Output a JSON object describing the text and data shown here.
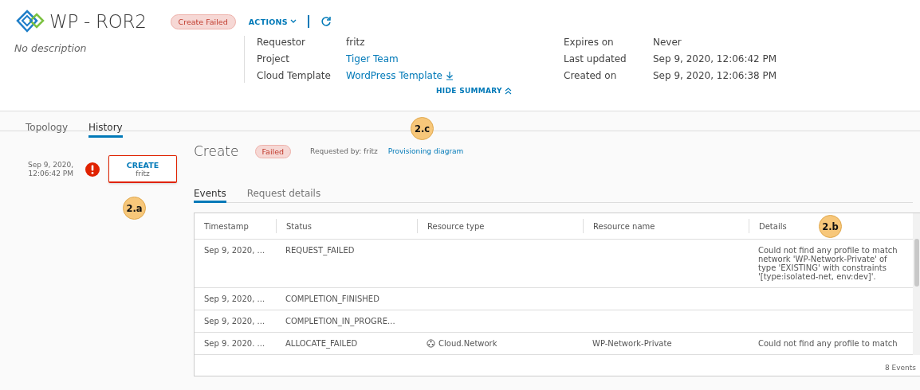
{
  "header": {
    "title": "WP - ROR2",
    "status": "Create Failed",
    "actions": "ACTIONS",
    "description": "No description",
    "summary_left": [
      {
        "label": "Requestor",
        "value": "fritz",
        "link": false,
        "download": false
      },
      {
        "label": "Project",
        "value": "Tiger Team",
        "link": true,
        "download": false
      },
      {
        "label": "Cloud Template",
        "value": "WordPress Template",
        "link": true,
        "download": true
      }
    ],
    "summary_right": [
      {
        "label": "Expires on",
        "value": "Never"
      },
      {
        "label": "Last updated",
        "value": "Sep 9, 2020, 12:06:42 PM"
      },
      {
        "label": "Created on",
        "value": "Sep 9, 2020, 12:06:38 PM"
      }
    ],
    "hide_summary": "HIDE SUMMARY"
  },
  "tabs": [
    {
      "label": "Topology",
      "selected": false
    },
    {
      "label": "History",
      "selected": true
    }
  ],
  "timeline": [
    {
      "date": "Sep 9, 2020,",
      "time": "12:06:42 PM",
      "failed": true,
      "action": "CREATE",
      "user": "fritz",
      "annotation": "2.a"
    }
  ],
  "request": {
    "title": "Create",
    "status": "Failed",
    "requested_by": "Requested by: fritz",
    "link": "Provisioning diagram",
    "annotation": "2.c"
  },
  "detail_tabs": [
    {
      "label": "Events",
      "selected": true
    },
    {
      "label": "Request details",
      "selected": false
    }
  ],
  "table": {
    "columns": [
      {
        "label": "Timestamp"
      },
      {
        "label": "Status"
      },
      {
        "label": "Resource type"
      },
      {
        "label": "Resource name"
      },
      {
        "label": "Details",
        "annotation": "2.b"
      }
    ],
    "rows": [
      {
        "timestamp": "Sep 9, 2020, ...",
        "status": "REQUEST_FAILED",
        "details": "Could not find any profile to match network 'WP-Network-Private' of type 'EXISTING' with constraints '[type:isolated-net, env:dev]'."
      },
      {
        "timestamp": "Sep 9, 2020, ...",
        "status": "COMPLETION_FINISHED"
      },
      {
        "timestamp": "Sep 9, 2020, ...",
        "status": "COMPLETION_IN_PROGRE..."
      },
      {
        "timestamp": "Sep 9. 2020. ...",
        "status": "ALLOCATE_FAILED",
        "resource_type": "Cloud.Network",
        "type_icon": true,
        "resource_name": "WP-Network-Private",
        "details": "Could not find any profile to match"
      }
    ],
    "footer": "8 Events"
  }
}
